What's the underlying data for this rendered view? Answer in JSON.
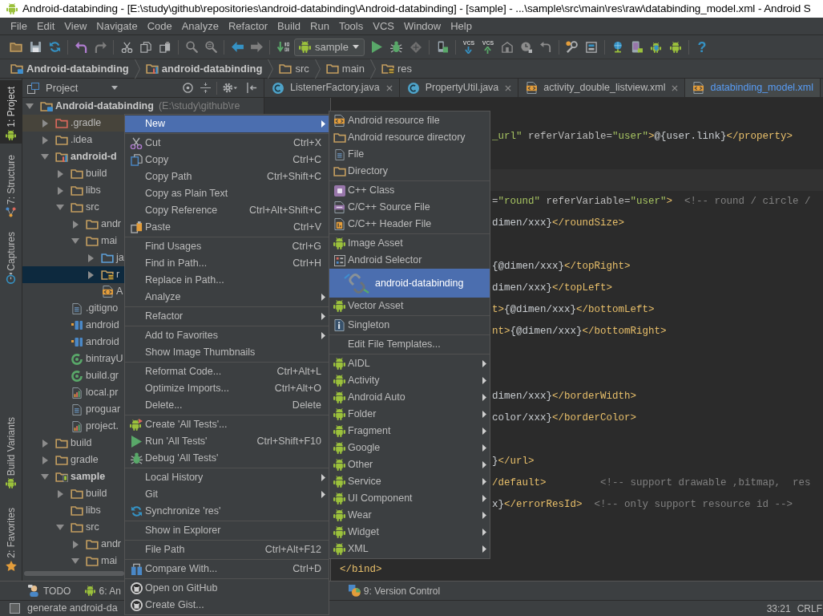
{
  "window": {
    "title": "Android-databinding - [E:\\study\\github\\repositories\\android-databinding\\Android-databinding] - [sample] - ...\\sample\\src\\main\\res\\raw\\databinding_model.xml - Android S"
  },
  "menu_bar": [
    "File",
    "Edit",
    "View",
    "Navigate",
    "Code",
    "Analyze",
    "Refactor",
    "Build",
    "Run",
    "Tools",
    "VCS",
    "Window",
    "Help"
  ],
  "toolbar": {
    "run_configuration": "sample",
    "vcs_labels": [
      "VCS",
      "VCS"
    ],
    "help_button": "?"
  },
  "breadcrumbs": [
    {
      "label": "Android-databinding",
      "kind": "project-module"
    },
    {
      "label": "android-databinding",
      "kind": "library-module"
    },
    {
      "label": "src",
      "kind": "folder"
    },
    {
      "label": "main",
      "kind": "folder"
    },
    {
      "label": "res",
      "kind": "resource-folder"
    }
  ],
  "left_stripe": {
    "top": [
      {
        "label": "1: Project",
        "selected": true
      },
      {
        "label": "7: Structure",
        "selected": false
      },
      {
        "label": "Captures",
        "selected": false
      }
    ],
    "bottom": [
      {
        "label": "Build Variants",
        "selected": false
      },
      {
        "label": "2: Favorites",
        "selected": false
      }
    ]
  },
  "project_panel": {
    "view": "Project",
    "tree": [
      {
        "label": "Android-databinding",
        "detail": "(E:\\study\\github\\re",
        "kind": "project-module",
        "expanded": true,
        "selected": false,
        "children": [
          {
            "label": ".gradle",
            "kind": "excluded-folder",
            "expanded": false,
            "selected": false
          },
          {
            "label": ".idea",
            "kind": "folder",
            "expanded": false,
            "selected": false
          },
          {
            "label": "android-d",
            "kind": "library-module",
            "expanded": true,
            "selected": false,
            "children": [
              {
                "label": "build",
                "kind": "folder",
                "expanded": false,
                "selected": false
              },
              {
                "label": "libs",
                "kind": "folder",
                "expanded": false,
                "selected": false
              },
              {
                "label": "src",
                "kind": "folder",
                "expanded": true,
                "selected": false,
                "children": [
                  {
                    "label": "andr",
                    "kind": "folder",
                    "expanded": false,
                    "selected": false
                  },
                  {
                    "label": "mai",
                    "kind": "folder",
                    "expanded": true,
                    "selected": false,
                    "children": [
                      {
                        "label": "ja",
                        "kind": "source-folder",
                        "expanded": false,
                        "selected": false
                      },
                      {
                        "label": "r",
                        "kind": "resource-folder",
                        "expanded": false,
                        "selected": true
                      },
                      {
                        "label": "A",
                        "kind": "manifest",
                        "selected": false
                      }
                    ]
                  }
                ]
              },
              {
                "label": ".gitigno",
                "kind": "text-file",
                "selected": false
              },
              {
                "label": "android",
                "kind": "module-file",
                "selected": false
              },
              {
                "label": "android",
                "kind": "module-file",
                "selected": false
              },
              {
                "label": "bintrayU",
                "kind": "gradle-file",
                "selected": false
              },
              {
                "label": "build.gr",
                "kind": "gradle-file",
                "selected": false
              },
              {
                "label": "local.pr",
                "kind": "properties-file",
                "selected": false
              },
              {
                "label": "proguar",
                "kind": "text-file",
                "selected": false
              },
              {
                "label": "project.",
                "kind": "properties-file",
                "selected": false
              }
            ]
          },
          {
            "label": "build",
            "kind": "folder",
            "expanded": false,
            "selected": false
          },
          {
            "label": "gradle",
            "kind": "folder",
            "expanded": false,
            "selected": false
          },
          {
            "label": "sample",
            "kind": "app-module",
            "expanded": true,
            "selected": false,
            "children": [
              {
                "label": "build",
                "kind": "folder",
                "expanded": false,
                "selected": false
              },
              {
                "label": "libs",
                "kind": "folder",
                "selected": false
              },
              {
                "label": "src",
                "kind": "folder",
                "expanded": true,
                "selected": false,
                "children": [
                  {
                    "label": "andr",
                    "kind": "folder",
                    "expanded": false,
                    "selected": false
                  },
                  {
                    "label": "mai",
                    "kind": "folder",
                    "expanded": true,
                    "selected": false
                  }
                ]
              }
            ]
          }
        ]
      }
    ]
  },
  "editor": {
    "tabs": [
      {
        "label": "ListenerFactory.java",
        "kind": "class",
        "selected": false,
        "closable": true
      },
      {
        "label": "PropertyUtil.java",
        "kind": "class",
        "selected": false,
        "closable": true
      },
      {
        "label": "activity_double_listview.xml",
        "kind": "xml",
        "selected": false,
        "closable": true
      },
      {
        "label": "databinding_model.xml",
        "kind": "xml",
        "selected": true,
        "closable": false
      }
    ],
    "lines": [
      {
        "kind": "blank"
      },
      {
        "kind": "fragment",
        "segments": [
          {
            "kind": "value",
            "text": "_url\""
          },
          {
            "kind": "attribute",
            "text": " referVariable="
          },
          {
            "kind": "value",
            "text": "\"user\""
          },
          {
            "kind": "tag",
            "text": ">"
          },
          {
            "kind": "text",
            "text": "@{user.link}"
          },
          {
            "kind": "tag",
            "text": "</property>"
          }
        ]
      },
      {
        "kind": "blank"
      },
      {
        "kind": "caret-line"
      },
      {
        "kind": "fragment",
        "segments": [
          {
            "kind": "attribute",
            "text": "="
          },
          {
            "kind": "value",
            "text": "\"round\""
          },
          {
            "kind": "attribute",
            "text": " referVariable="
          },
          {
            "kind": "value",
            "text": "\"user\""
          },
          {
            "kind": "tag",
            "text": ">"
          },
          {
            "kind": "comment",
            "text": "  <!-- round / circle /"
          }
        ]
      },
      {
        "kind": "fragment",
        "segments": [
          {
            "kind": "text",
            "text": "dimen/xxx}"
          },
          {
            "kind": "tag",
            "text": "</roundSize>"
          }
        ]
      },
      {
        "kind": "blank"
      },
      {
        "kind": "fragment",
        "segments": [
          {
            "kind": "text",
            "text": "{@dimen/xxx}"
          },
          {
            "kind": "tag",
            "text": "</topRight>"
          }
        ]
      },
      {
        "kind": "fragment",
        "segments": [
          {
            "kind": "text",
            "text": "dimen/xxx}"
          },
          {
            "kind": "tag",
            "text": "</topLeft>"
          }
        ]
      },
      {
        "kind": "fragment",
        "segments": [
          {
            "kind": "tag",
            "text": "t>"
          },
          {
            "kind": "text",
            "text": "{@dimen/xxx}"
          },
          {
            "kind": "tag",
            "text": "</bottomLeft>"
          }
        ]
      },
      {
        "kind": "fragment",
        "segments": [
          {
            "kind": "tag",
            "text": "nt>"
          },
          {
            "kind": "text",
            "text": "{@dimen/xxx}"
          },
          {
            "kind": "tag",
            "text": "</bottomRight>"
          }
        ]
      },
      {
        "kind": "blank"
      },
      {
        "kind": "blank"
      },
      {
        "kind": "fragment",
        "segments": [
          {
            "kind": "text",
            "text": "dimen/xxx}"
          },
          {
            "kind": "tag",
            "text": "</borderWidth>"
          }
        ]
      },
      {
        "kind": "fragment",
        "segments": [
          {
            "kind": "text",
            "text": "color/xxx}"
          },
          {
            "kind": "tag",
            "text": "</borderColor>"
          }
        ]
      },
      {
        "kind": "blank"
      },
      {
        "kind": "fragment",
        "segments": [
          {
            "kind": "text",
            "text": "}"
          },
          {
            "kind": "tag",
            "text": "</url>"
          }
        ]
      },
      {
        "kind": "fragment",
        "segments": [
          {
            "kind": "tag",
            "text": "/default>"
          },
          {
            "kind": "comment",
            "text": "         <!-- support drawable ,bitmap,  res"
          }
        ]
      },
      {
        "kind": "fragment",
        "segments": [
          {
            "kind": "text",
            "text": "x}"
          },
          {
            "kind": "tag",
            "text": "</errorResId>"
          },
          {
            "kind": "comment",
            "text": "  <!-- only support resource id -->"
          }
        ]
      },
      {
        "kind": "blank"
      },
      {
        "kind": "blank"
      },
      {
        "kind": "full",
        "segments": [
          {
            "kind": "tag",
            "text": "</bind>"
          }
        ]
      }
    ]
  },
  "context_menu": {
    "groups": [
      {
        "items": [
          {
            "label": "New",
            "submenu": true,
            "selected": true
          }
        ]
      },
      {
        "items": [
          {
            "label": "Cut",
            "shortcut": "Ctrl+X",
            "submenu": false,
            "selected": false
          },
          {
            "label": "Copy",
            "shortcut": "Ctrl+C",
            "submenu": false,
            "selected": false
          },
          {
            "label": "Copy Path",
            "shortcut": "Ctrl+Shift+C",
            "submenu": false,
            "selected": false
          },
          {
            "label": "Copy as Plain Text",
            "submenu": false,
            "selected": false
          },
          {
            "label": "Copy Reference",
            "shortcut": "Ctrl+Alt+Shift+C",
            "submenu": false,
            "selected": false
          },
          {
            "label": "Paste",
            "shortcut": "Ctrl+V",
            "submenu": false,
            "selected": false
          }
        ]
      },
      {
        "items": [
          {
            "label": "Find Usages",
            "shortcut": "Ctrl+G",
            "submenu": false,
            "selected": false
          },
          {
            "label": "Find in Path...",
            "shortcut": "Ctrl+H",
            "submenu": false,
            "selected": false
          },
          {
            "label": "Replace in Path...",
            "submenu": false,
            "selected": false
          },
          {
            "label": "Analyze",
            "submenu": true,
            "selected": false
          }
        ]
      },
      {
        "items": [
          {
            "label": "Refactor",
            "submenu": true,
            "selected": false
          }
        ]
      },
      {
        "items": [
          {
            "label": "Add to Favorites",
            "submenu": true,
            "selected": false
          },
          {
            "label": "Show Image Thumbnails",
            "submenu": false,
            "selected": false
          }
        ]
      },
      {
        "items": [
          {
            "label": "Reformat Code...",
            "shortcut": "Ctrl+Alt+L",
            "submenu": false,
            "selected": false
          },
          {
            "label": "Optimize Imports...",
            "shortcut": "Ctrl+Alt+O",
            "submenu": false,
            "selected": false
          },
          {
            "label": "Delete...",
            "shortcut": "Delete",
            "submenu": false,
            "selected": false
          }
        ]
      },
      {
        "items": [
          {
            "label": "Create 'All Tests'...",
            "submenu": false,
            "selected": false
          },
          {
            "label": "Run 'All Tests'",
            "shortcut": "Ctrl+Shift+F10",
            "submenu": false,
            "selected": false
          },
          {
            "label": "Debug 'All Tests'",
            "submenu": false,
            "selected": false
          }
        ]
      },
      {
        "items": [
          {
            "label": "Local History",
            "submenu": true,
            "selected": false
          },
          {
            "label": "Git",
            "submenu": true,
            "selected": false
          },
          {
            "label": "Synchronize 'res'",
            "submenu": false,
            "selected": false
          }
        ]
      },
      {
        "items": [
          {
            "label": "Show in Explorer",
            "submenu": false,
            "selected": false
          }
        ]
      },
      {
        "items": [
          {
            "label": "File Path",
            "shortcut": "Ctrl+Alt+F12",
            "submenu": false,
            "selected": false
          }
        ]
      },
      {
        "items": [
          {
            "label": "Compare With...",
            "shortcut": "Ctrl+D",
            "submenu": false,
            "selected": false
          }
        ]
      },
      {
        "items": [
          {
            "label": "Open on GitHub",
            "submenu": false,
            "selected": false
          },
          {
            "label": "Create Gist...",
            "submenu": false,
            "selected": false
          }
        ]
      }
    ]
  },
  "new_submenu": {
    "groups": [
      {
        "items": [
          {
            "label": "Android resource file",
            "submenu": false,
            "selected": false
          },
          {
            "label": "Android resource directory",
            "submenu": false,
            "selected": false
          },
          {
            "label": "File",
            "submenu": false,
            "selected": false
          },
          {
            "label": "Directory",
            "submenu": false,
            "selected": false
          }
        ]
      },
      {
        "items": [
          {
            "label": "C++ Class",
            "submenu": false,
            "selected": false
          },
          {
            "label": "C/C++ Source File",
            "submenu": false,
            "selected": false
          },
          {
            "label": "C/C++ Header File",
            "submenu": false,
            "selected": false
          }
        ]
      },
      {
        "items": [
          {
            "label": "Image Asset",
            "submenu": false,
            "selected": false
          },
          {
            "label": "Android Selector",
            "submenu": false,
            "selected": false
          },
          {
            "label": "android-databinding",
            "submenu": false,
            "selected": true
          },
          {
            "label": "Vector Asset",
            "submenu": false,
            "selected": false
          }
        ]
      },
      {
        "items": [
          {
            "label": "Singleton",
            "submenu": false,
            "selected": false
          }
        ]
      },
      {
        "items": [
          {
            "label": "Edit File Templates...",
            "submenu": false,
            "selected": false
          }
        ]
      },
      {
        "items": [
          {
            "label": "AIDL",
            "submenu": true,
            "selected": false
          },
          {
            "label": "Activity",
            "submenu": true,
            "selected": false
          },
          {
            "label": "Android Auto",
            "submenu": true,
            "selected": false
          },
          {
            "label": "Folder",
            "submenu": true,
            "selected": false
          },
          {
            "label": "Fragment",
            "submenu": true,
            "selected": false
          },
          {
            "label": "Google",
            "submenu": true,
            "selected": false
          },
          {
            "label": "Other",
            "submenu": true,
            "selected": false
          },
          {
            "label": "Service",
            "submenu": true,
            "selected": false
          },
          {
            "label": "UI Component",
            "submenu": true,
            "selected": false
          },
          {
            "label": "Wear",
            "submenu": true,
            "selected": false
          },
          {
            "label": "Widget",
            "submenu": true,
            "selected": false
          },
          {
            "label": "XML",
            "submenu": true,
            "selected": false
          }
        ]
      }
    ]
  },
  "bottom_tool_bar": [
    {
      "label": "TODO"
    },
    {
      "label": "6: An"
    },
    {
      "label": "9: Version Control"
    }
  ],
  "status_bar": {
    "message": "generate android-da",
    "position": "33:21",
    "line_separator": "CRLF"
  }
}
